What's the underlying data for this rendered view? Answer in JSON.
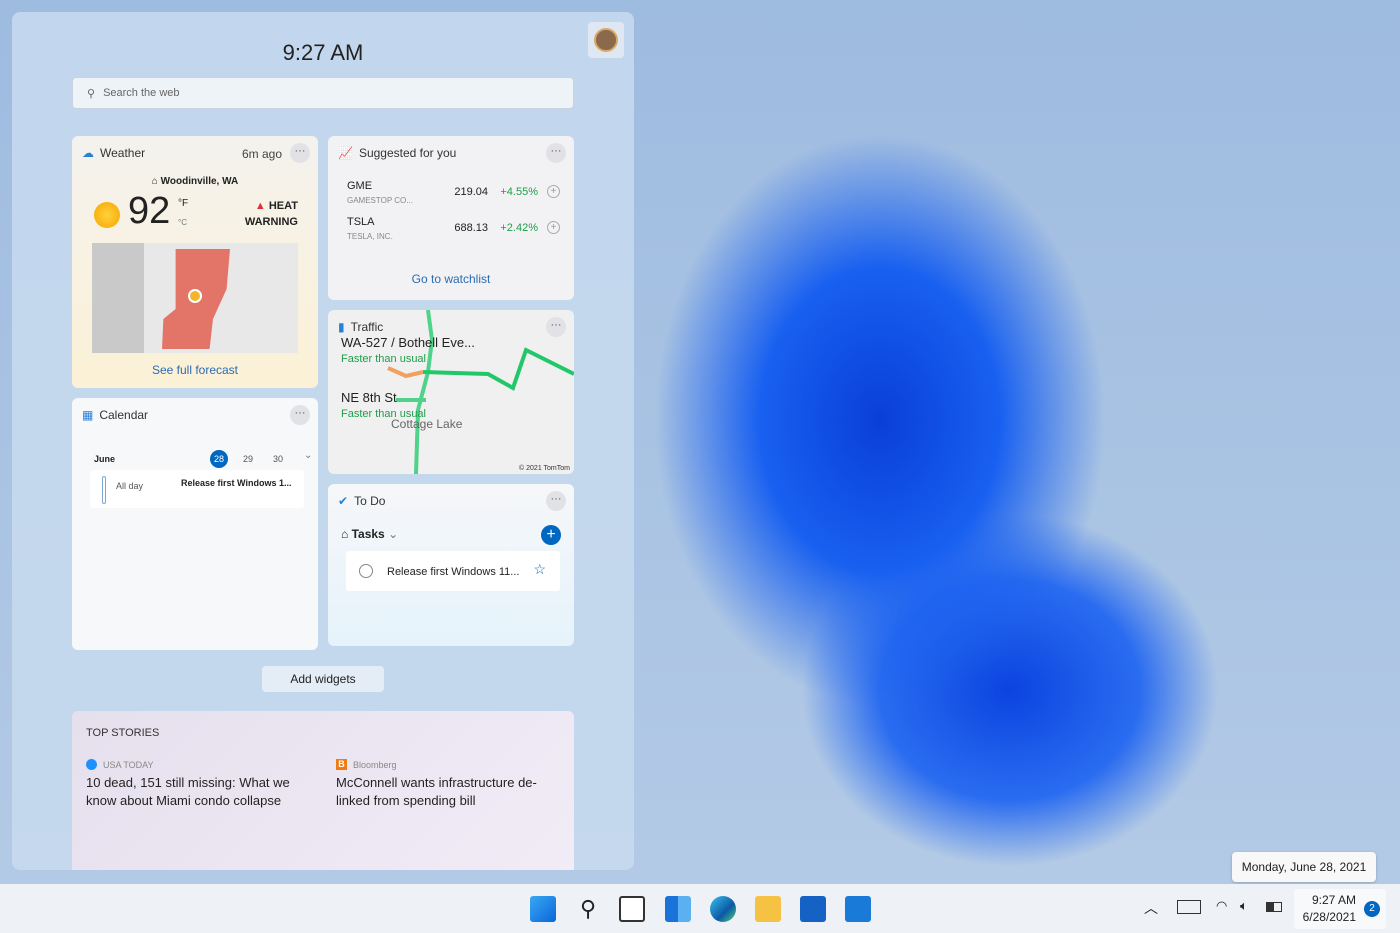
{
  "header": {
    "time": "9:27 AM",
    "search_placeholder": "Search the web"
  },
  "weather": {
    "title": "Weather",
    "updated": "6m ago",
    "location": "Woodinville, WA",
    "temp": "92",
    "unit_f": "°F",
    "unit_c": "°C",
    "alert_line1": "HEAT",
    "alert_line2": "WARNING",
    "link": "See full forecast"
  },
  "stocks": {
    "title": "Suggested for you",
    "items": [
      {
        "symbol": "GME",
        "name": "GAMESTOP CO...",
        "price": "219.04",
        "change": "+4.55%"
      },
      {
        "symbol": "TSLA",
        "name": "TESLA, INC.",
        "price": "688.13",
        "change": "+2.42%"
      }
    ],
    "link": "Go to watchlist"
  },
  "traffic": {
    "title": "Traffic",
    "routes": [
      {
        "name": "WA-527 / Bothell Eve...",
        "status": "Faster than usual"
      },
      {
        "name": "NE 8th St",
        "status": "Faster than usual"
      }
    ],
    "map_label": "Cottage Lake",
    "credit": "© 2021 TomTom"
  },
  "calendar": {
    "title": "Calendar",
    "month": "June",
    "days": [
      "28",
      "29",
      "30"
    ],
    "event_time": "All day",
    "event_title": "Release first Windows 1..."
  },
  "todo": {
    "title": "To Do",
    "list": "Tasks",
    "task": "Release first Windows 11..."
  },
  "add_widgets": "Add widgets",
  "stories": {
    "title": "TOP STORIES",
    "items": [
      {
        "source": "USA TODAY",
        "headline": "10 dead, 151 still missing: What we know about Miami condo collapse"
      },
      {
        "source": "Bloomberg",
        "headline": "McConnell wants infrastructure de-linked from spending bill"
      }
    ]
  },
  "tray": {
    "tooltip": "Monday, June 28, 2021",
    "time": "9:27 AM",
    "date": "6/28/2021",
    "notifications": "2"
  },
  "colors": {
    "accent": "#0067c0",
    "positive": "#1e9e4a",
    "heat": "#e06060"
  }
}
